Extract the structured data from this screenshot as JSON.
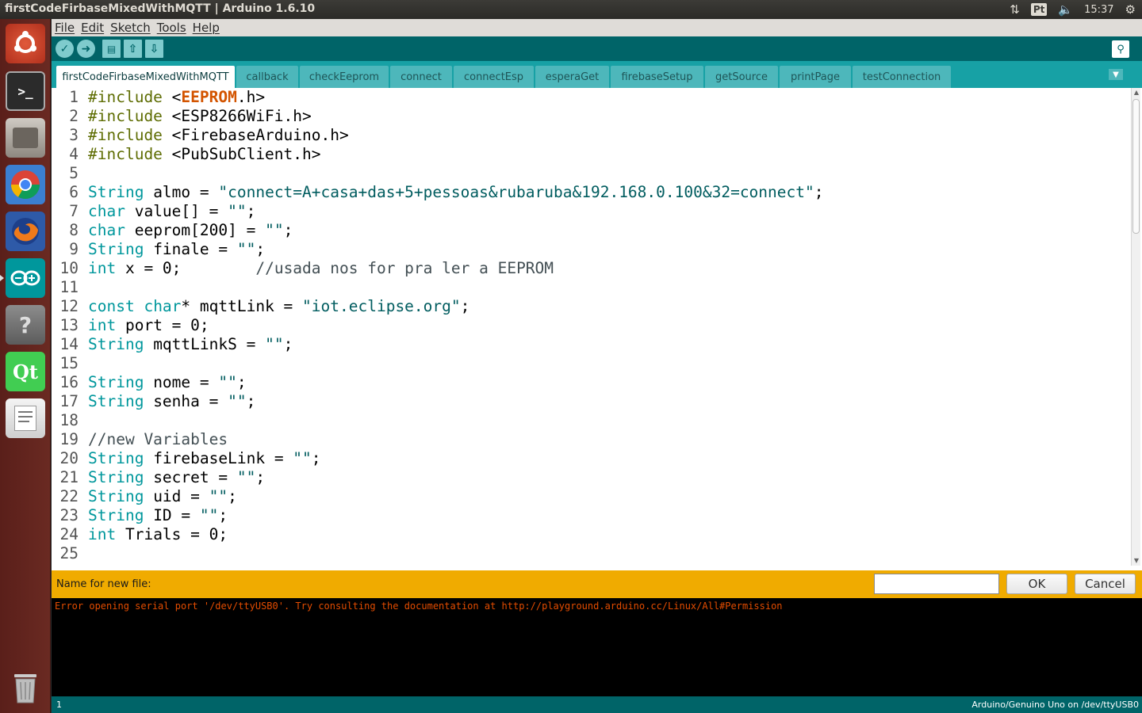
{
  "system": {
    "window_title": "firstCodeFirbaseMixedWithMQTT | Arduino 1.6.10",
    "keyboard_layout": "Pt",
    "clock": "15:37"
  },
  "launcher": {
    "items": [
      "ubuntu-dash",
      "terminal",
      "files",
      "chrome",
      "firefox",
      "arduino",
      "help",
      "qt-creator",
      "text-editor",
      "trash"
    ]
  },
  "menu": [
    "File",
    "Edit",
    "Sketch",
    "Tools",
    "Help"
  ],
  "toolbar": {
    "buttons": [
      "verify",
      "upload",
      "new",
      "open",
      "save"
    ],
    "serial_monitor": "serial-monitor"
  },
  "tabs": [
    {
      "label": "firstCodeFirbaseMixedWithMQTT",
      "active": true
    },
    {
      "label": "callback",
      "active": false
    },
    {
      "label": "checkEeprom",
      "active": false
    },
    {
      "label": "connect",
      "active": false
    },
    {
      "label": "connectEsp",
      "active": false
    },
    {
      "label": "esperaGet",
      "active": false
    },
    {
      "label": "firebaseSetup",
      "active": false
    },
    {
      "label": "getSource",
      "active": false
    },
    {
      "label": "printPage",
      "active": false
    },
    {
      "label": "testConnection",
      "active": false
    }
  ],
  "code": {
    "lines": [
      "1",
      "2",
      "3",
      "4",
      "5",
      "6",
      "7",
      "8",
      "9",
      "10",
      "11",
      "12",
      "13",
      "14",
      "15",
      "16",
      "17",
      "18",
      "19",
      "20",
      "21",
      "22",
      "23",
      "24",
      "25"
    ]
  },
  "prompt": {
    "label": "Name for new file:",
    "input_value": "",
    "ok": "OK",
    "cancel": "Cancel"
  },
  "console": {
    "message": "Error opening serial port '/dev/ttyUSB0'. Try consulting the documentation at http://playground.arduino.cc/Linux/All#Permission"
  },
  "status": {
    "line": "1",
    "board": "Arduino/Genuino Uno on /dev/ttyUSB0"
  },
  "colors": {
    "arduino_teal": "#006468",
    "tab_bar": "#17a1a5",
    "prompt_bar": "#f0ab00",
    "console_error": "#e34c00"
  }
}
